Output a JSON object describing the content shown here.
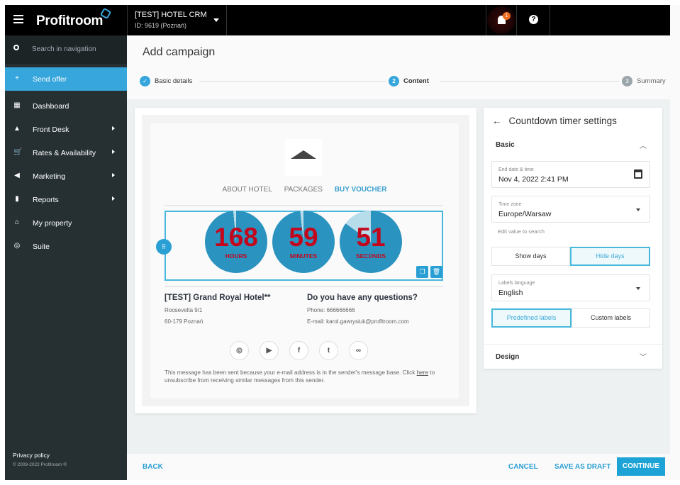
{
  "topbar": {
    "brand": "Profitroom",
    "hotel_name": "[TEST] HOTEL CRM",
    "hotel_id": "ID: 9619  (Poznań)",
    "notifications": "1",
    "help": "?"
  },
  "sidebar": {
    "search_placeholder": "Search in navigation",
    "items": [
      {
        "label": "Send offer",
        "icon": "plus-circle-icon",
        "glyph": "+",
        "arrow": false
      },
      {
        "label": "Dashboard",
        "icon": "dashboard-icon",
        "glyph": "▦",
        "arrow": false
      },
      {
        "label": "Front Desk",
        "icon": "bell-desk-icon",
        "glyph": "▲",
        "arrow": true
      },
      {
        "label": "Rates & Availability",
        "icon": "cart-icon",
        "glyph": "🛒",
        "arrow": true
      },
      {
        "label": "Marketing",
        "icon": "megaphone-icon",
        "glyph": "◀",
        "arrow": true
      },
      {
        "label": "Reports",
        "icon": "bar-chart-icon",
        "glyph": "▮",
        "arrow": true
      },
      {
        "label": "My property",
        "icon": "home-icon",
        "glyph": "⌂",
        "arrow": false
      },
      {
        "label": "Suite",
        "icon": "suite-icon",
        "glyph": "◎",
        "arrow": false
      }
    ],
    "privacy": "Privacy policy",
    "copyright": "© 2009-2022 Profitroom ®"
  },
  "header": {
    "title": "Add campaign",
    "steps": [
      {
        "num": "✓",
        "label": "Basic details"
      },
      {
        "num": "2",
        "label": "Content"
      },
      {
        "num": "3",
        "label": "Summary"
      }
    ]
  },
  "email": {
    "nav": [
      "ABOUT HOTEL",
      "PACKAGES",
      "BUY VOUCHER"
    ],
    "timer": [
      {
        "value": "168",
        "label": "HOURS",
        "fill": 0.985
      },
      {
        "value": "59",
        "label": "MINUTES",
        "fill": 0.983
      },
      {
        "value": "51",
        "label": "SECONDS",
        "fill": 0.85
      }
    ],
    "hotel_name": "[TEST] Grand Royal Hotel**",
    "street": "Roosevelta 9/1",
    "city": "60-179 Poznań",
    "questions": "Do you have any questions?",
    "phone": "Phone: 666666666",
    "email": "E-mail: karol.gawrysiuk@profitroom.com",
    "disclaimer_pre": "This message has been sent because your e-mail address is in the sender's message base. Click ",
    "disclaimer_link": "here",
    "disclaimer_post": " to unsubscribe from receiving similar messages from this sender."
  },
  "panel": {
    "title": "Countdown timer settings",
    "basic": "Basic",
    "end_label": "End date & time",
    "end_value": "Nov 4, 2022 2:41 PM",
    "tz_label": "Time zone",
    "tz_value": "Europe/Warsaw",
    "tz_hint": "Edit value to search",
    "show_days": "Show days",
    "hide_days": "Hide days",
    "lang_label": "Labels language",
    "lang_value": "English",
    "predefined": "Predefined labels",
    "custom": "Custom labels",
    "design": "Design"
  },
  "footer": {
    "back": "BACK",
    "cancel": "CANCEL",
    "draft": "SAVE AS DRAFT",
    "continue": "CONTINUE"
  },
  "colors": {
    "accent": "#37a6dc",
    "gauge": "#2b93c0",
    "gauge_light": "#b7dcea",
    "timer_text": "#c3061c"
  }
}
